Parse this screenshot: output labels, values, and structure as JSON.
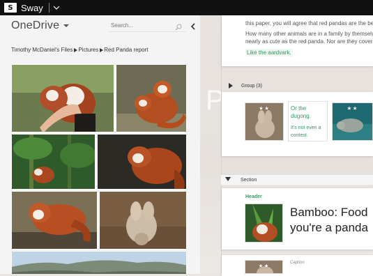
{
  "app": {
    "title": "Sway",
    "logo_letter": "S",
    "logo_icon": "sway-logo-icon",
    "menu_icon": "chevron-down-icon"
  },
  "panel": {
    "title": "OneDrive",
    "search_placeholder": "Search...",
    "breadcrumb": [
      "Timothy McDaniel's Files",
      "Pictures",
      "Red Panda report"
    ]
  },
  "stage": {
    "ghost_text": "Pa",
    "card1": {
      "line1": "this paper, you will agree that red pandas are the best a",
      "line2": "How many other animals are in a family by themselves?",
      "line3": "nearly as cute as the red panda. Nor are they covered i",
      "link": "Like the aardvark."
    },
    "group": {
      "label": "Group (3)",
      "text1": "Or the dugong.",
      "text2": "It's not even a",
      "text3": "contest.",
      "stars": "★★"
    },
    "section": {
      "label": "Section",
      "header_label": "Header",
      "heading_line1": "Bamboo: Food",
      "heading_line2": "you're a panda",
      "caption_label": "Caption"
    }
  },
  "colors": {
    "accent_green": "#2f9a62",
    "topbar": "#111111"
  }
}
